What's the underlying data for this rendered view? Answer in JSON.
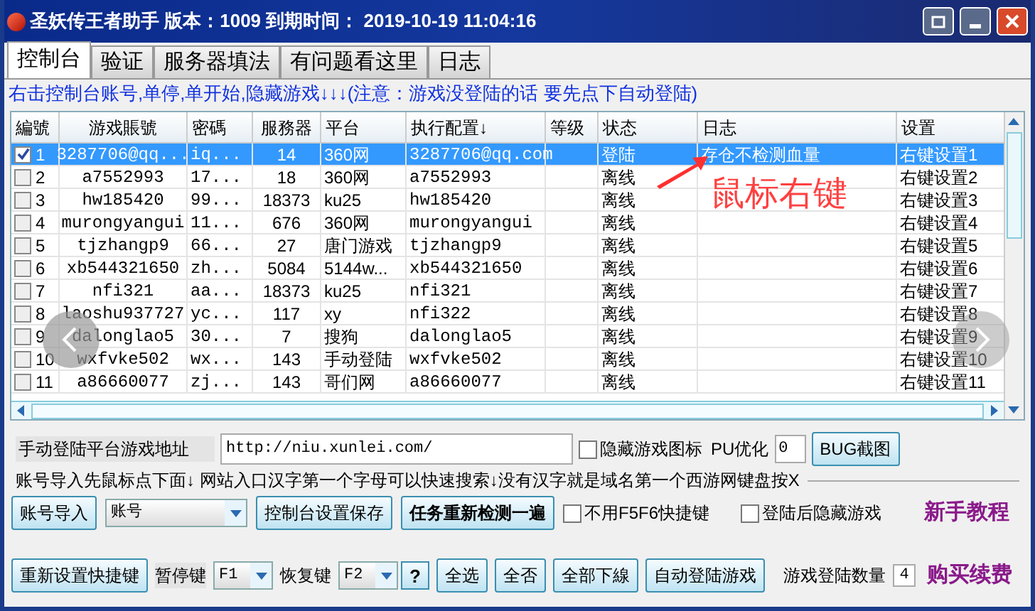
{
  "window": {
    "title": "圣妖传王者助手 版本：1009 到期时间： 2019-10-19 11:04:16"
  },
  "tabs": [
    {
      "label": "控制台",
      "selected": true
    },
    {
      "label": "验证",
      "selected": false
    },
    {
      "label": "服务器填法",
      "selected": false
    },
    {
      "label": "有问题看这里",
      "selected": false
    },
    {
      "label": "日志",
      "selected": false
    }
  ],
  "hint": "右击控制台账号,单停,单开始,隐藏游戏↓↓↓(注意：游戏没登陆的话 要先点下自动登陆)",
  "table": {
    "columns": [
      "編號",
      "游戏賬號",
      "密碼",
      "服務器",
      "平台",
      "执行配置↓",
      "等级",
      "状态",
      "日志",
      "设置"
    ],
    "rows": [
      {
        "checked": true,
        "selected": true,
        "cells": [
          "1",
          "3287706@qq...",
          "iq...",
          "14",
          "360网",
          "3287706@qq.com",
          "",
          "登陆",
          "存仓不检测血量",
          "右键设置1"
        ]
      },
      {
        "checked": false,
        "selected": false,
        "cells": [
          "2",
          "a7552993",
          "17...",
          "18",
          "360网",
          "a7552993",
          "",
          "离线",
          "",
          "右键设置2"
        ]
      },
      {
        "checked": false,
        "selected": false,
        "cells": [
          "3",
          "hw185420",
          "99...",
          "18373",
          "ku25",
          "hw185420",
          "",
          "离线",
          "",
          "右键设置3"
        ]
      },
      {
        "checked": false,
        "selected": false,
        "cells": [
          "4",
          "murongyangui",
          "11...",
          "676",
          "360网",
          "murongyangui",
          "",
          "离线",
          "",
          "右键设置4"
        ]
      },
      {
        "checked": false,
        "selected": false,
        "cells": [
          "5",
          "tjzhangp9",
          "66...",
          "27",
          "唐门游戏",
          "tjzhangp9",
          "",
          "离线",
          "",
          "右键设置5"
        ]
      },
      {
        "checked": false,
        "selected": false,
        "cells": [
          "6",
          "xb544321650",
          "zh...",
          "5084",
          "5144w...",
          "xb544321650",
          "",
          "离线",
          "",
          "右键设置6"
        ]
      },
      {
        "checked": false,
        "selected": false,
        "cells": [
          "7",
          "nfi321",
          "aa...",
          "18373",
          "ku25",
          "nfi321",
          "",
          "离线",
          "",
          "右键设置7"
        ]
      },
      {
        "checked": false,
        "selected": false,
        "cells": [
          "8",
          "laoshu937727",
          "yc...",
          "117",
          "xy",
          "nfi322",
          "",
          "离线",
          "",
          "右键设置8"
        ]
      },
      {
        "checked": false,
        "selected": false,
        "cells": [
          "9",
          "dalonglao5",
          "30...",
          "7",
          "搜狗",
          "dalonglao5",
          "",
          "离线",
          "",
          "右键设置9"
        ]
      },
      {
        "checked": false,
        "selected": false,
        "cells": [
          "10",
          "wxfvke502",
          "wx...",
          "143",
          "手动登陆",
          "wxfvke502",
          "",
          "离线",
          "",
          "右键设置10"
        ]
      },
      {
        "checked": false,
        "selected": false,
        "cells": [
          "11",
          "a86660077",
          "zj...",
          "143",
          "哥们网",
          "a86660077",
          "",
          "离线",
          "",
          "右键设置11"
        ]
      }
    ]
  },
  "annotation": "鼠标右键",
  "address": {
    "label": "手动登陆平台游戏地址",
    "value": "http://niu.xunlei.com/"
  },
  "hide_icon": {
    "label": "隐藏游戏图标",
    "checked": false
  },
  "pu": {
    "label": "PU优化",
    "value": "0"
  },
  "bug_button": "BUG截图",
  "import_note": "账号导入先鼠标点下面↓ 网站入口汉字第一个字母可以快速搜索↓没有汉字就是域名第一个西游网键盘按X",
  "import_button": "账号导入",
  "account_select": "账号",
  "save_button": "控制台设置保存",
  "recheck_button": "任务重新检测一遍",
  "no_f5f6": {
    "label": "不用F5F6快捷键",
    "checked": false
  },
  "hide_after": {
    "label": "登陆后隐藏游戏",
    "checked": false
  },
  "tutorial_link": "新手教程",
  "reset_button": "重新设置快捷键",
  "pause": {
    "label": "暂停键",
    "value": "F1"
  },
  "resume": {
    "label": "恢复键",
    "value": "F2"
  },
  "help_button": "?",
  "action_buttons": [
    "全选",
    "全否",
    "全部下線",
    "自动登陆游戏"
  ],
  "count": {
    "label": "游戏登陆数量",
    "value": "4"
  },
  "buy_link": "购买续费"
}
